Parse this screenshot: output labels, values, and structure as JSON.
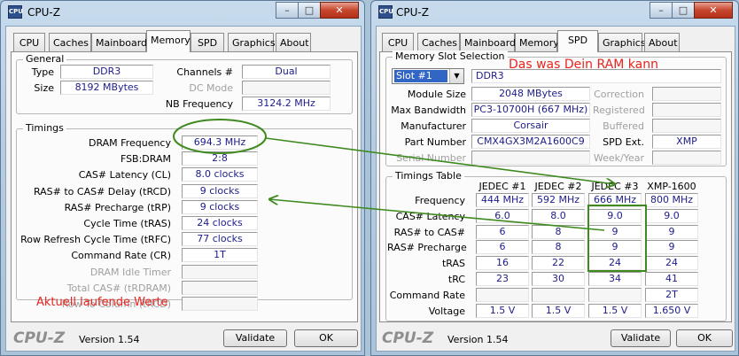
{
  "left": {
    "title": "CPU-Z",
    "caption_buttons": {
      "min": "–",
      "max": "□",
      "close": "✕"
    },
    "tabs": [
      "CPU",
      "Caches",
      "Mainboard",
      "Memory",
      "SPD",
      "Graphics",
      "About"
    ],
    "general": {
      "title": "General",
      "type_label": "Type",
      "type_value": "DDR3",
      "size_label": "Size",
      "size_value": "8192 MBytes",
      "channels_label": "Channels #",
      "channels_value": "Dual",
      "dcmode_label": "DC Mode",
      "nbfreq_label": "NB Frequency",
      "nbfreq_value": "3124.2 MHz"
    },
    "timings": {
      "title": "Timings",
      "rows": [
        {
          "label": "DRAM Frequency",
          "value": "694.3 MHz"
        },
        {
          "label": "FSB:DRAM",
          "value": "2:8"
        },
        {
          "label": "CAS# Latency (CL)",
          "value": "8.0 clocks"
        },
        {
          "label": "RAS# to CAS# Delay (tRCD)",
          "value": "9 clocks"
        },
        {
          "label": "RAS# Precharge (tRP)",
          "value": "9 clocks"
        },
        {
          "label": "Cycle Time (tRAS)",
          "value": "24 clocks"
        },
        {
          "label": "Row Refresh Cycle Time (tRFC)",
          "value": "77 clocks"
        },
        {
          "label": "Command Rate (CR)",
          "value": "1T"
        },
        {
          "label": "DRAM Idle Timer",
          "value": ""
        },
        {
          "label": "Total CAS# (tRDRAM)",
          "value": ""
        },
        {
          "label": "Row To Column (tRCD)",
          "value": ""
        }
      ]
    },
    "annotation": "Aktuell laufende Werte",
    "logo": "CPU-Z",
    "version": "Version 1.54",
    "validate": "Validate",
    "ok": "OK"
  },
  "right": {
    "title": "CPU-Z",
    "caption_buttons": {
      "min": "–",
      "max": "□",
      "close": "✕"
    },
    "tabs": [
      "CPU",
      "Caches",
      "Mainboard",
      "Memory",
      "SPD",
      "Graphics",
      "About"
    ],
    "slot_group_title": "Memory Slot Selection",
    "slot_selected": "Slot #1",
    "module_type": "DDR3",
    "annotation": "Das was Dein RAM kann",
    "info_rows": [
      {
        "label": "Module Size",
        "value": "2048 MBytes",
        "rlabel": "Correction",
        "rvalue": ""
      },
      {
        "label": "Max Bandwidth",
        "value": "PC3-10700H (667 MHz)",
        "rlabel": "Registered",
        "rvalue": ""
      },
      {
        "label": "Manufacturer",
        "value": "Corsair",
        "rlabel": "Buffered",
        "rvalue": ""
      },
      {
        "label": "Part Number",
        "value": "CMX4GX3M2A1600C9",
        "rlabel": "SPD Ext.",
        "rvalue": "XMP"
      },
      {
        "label": "Serial Number",
        "value": "",
        "rlabel": "Week/Year",
        "rvalue": ""
      }
    ],
    "timings_table": {
      "title": "Timings Table",
      "columns": [
        "JEDEC #1",
        "JEDEC #2",
        "JEDEC #3",
        "XMP-1600"
      ],
      "rows": [
        {
          "label": "Frequency",
          "values": [
            "444 MHz",
            "592 MHz",
            "666 MHz",
            "800 MHz"
          ]
        },
        {
          "label": "CAS# Latency",
          "values": [
            "6.0",
            "8.0",
            "9.0",
            "9.0"
          ]
        },
        {
          "label": "RAS# to CAS#",
          "values": [
            "6",
            "8",
            "9",
            "9"
          ]
        },
        {
          "label": "RAS# Precharge",
          "values": [
            "6",
            "8",
            "9",
            "9"
          ]
        },
        {
          "label": "tRAS",
          "values": [
            "16",
            "22",
            "24",
            "24"
          ]
        },
        {
          "label": "tRC",
          "values": [
            "23",
            "30",
            "34",
            "41"
          ]
        },
        {
          "label": "Command Rate",
          "values": [
            "",
            "",
            "",
            "2T"
          ]
        },
        {
          "label": "Voltage",
          "values": [
            "1.5 V",
            "1.5 V",
            "1.5 V",
            "1.650 V"
          ]
        }
      ]
    },
    "logo": "CPU-Z",
    "version": "Version 1.54",
    "validate": "Validate",
    "ok": "OK"
  },
  "colors": {
    "annotation_red": "#e8241d",
    "annotation_green": "#3f8a1f",
    "value_text": "#1c1c8a"
  }
}
